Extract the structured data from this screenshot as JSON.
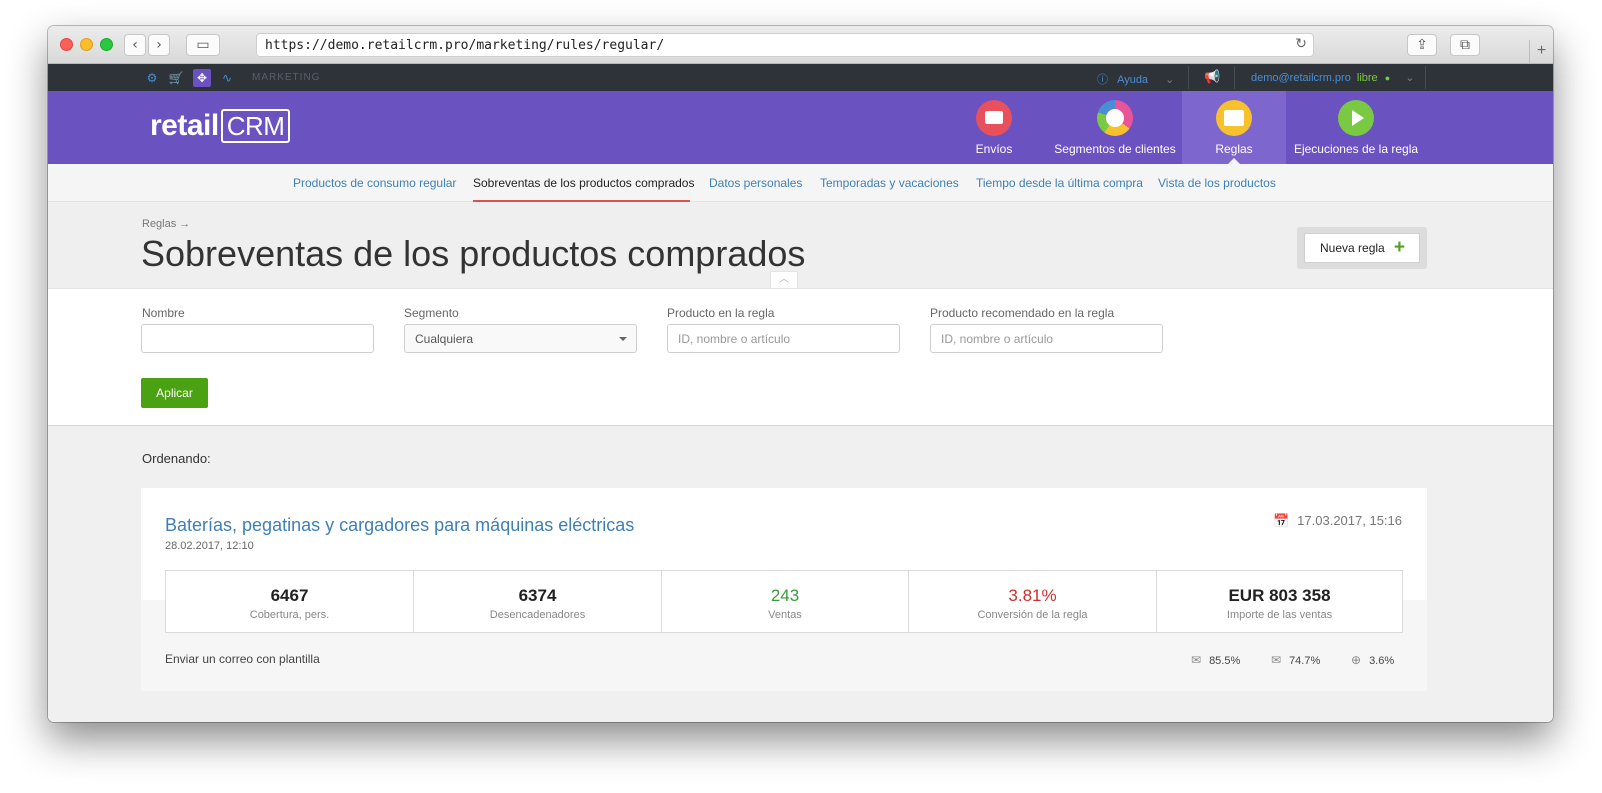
{
  "browser": {
    "url": "https://demo.retailcrm.pro/marketing/rules/regular/"
  },
  "appbar": {
    "section_label": "MARKETING",
    "help_label": "Ayuda",
    "user_email": "demo@retailcrm.pro",
    "user_status": "libre",
    "accent_color": "#4a8fd6"
  },
  "header": {
    "logo_text": "retail",
    "logo_crm": "CRM",
    "brand_color": "#6a52c1",
    "nav": [
      {
        "label": "Envíos",
        "icon": "envelope-icon",
        "color": "#e8505b"
      },
      {
        "label": "Segmentos de clientes",
        "icon": "segment-chart-icon",
        "color": "#e9539a"
      },
      {
        "label": "Reglas",
        "icon": "rules-list-icon",
        "color": "#f6c12d"
      },
      {
        "label": "Ejecuciones de la regla",
        "icon": "play-icon",
        "color": "#7ac943"
      }
    ]
  },
  "subnav": {
    "tabs": [
      "Productos de consumo regular",
      "Sobreventas de los productos comprados",
      "Datos personales",
      "Temporadas y vacaciones",
      "Tiempo desde la última compra",
      "Vista de los productos"
    ],
    "active_index": 1
  },
  "page": {
    "breadcrumb": "Reglas →",
    "title": "Sobreventas de los productos comprados",
    "new_rule_label": "Nueva regla",
    "new_rule_plus": "+"
  },
  "filters": {
    "name_label": "Nombre",
    "name_value": "",
    "segment_label": "Segmento",
    "segment_value": "Cualquiera",
    "product_label": "Producto en la regla",
    "product_placeholder": "ID, nombre o artículo",
    "recommended_label": "Producto recomendado en la regla",
    "recommended_placeholder": "ID, nombre o artículo",
    "apply_label": "Aplicar"
  },
  "list": {
    "ordering_label": "Ordenando:",
    "rules": [
      {
        "title": "Baterías, pegatinas y cargadores para máquinas eléctricas",
        "created": "28.02.2017, 12:10",
        "updated": "17.03.2017, 15:16",
        "stats": [
          {
            "value": "6467",
            "label": "Cobertura, pers.",
            "color": "#222222"
          },
          {
            "value": "6374",
            "label": "Desencadenadores",
            "color": "#222222"
          },
          {
            "value": "243",
            "label": "Ventas",
            "color": "#3c9a3c"
          },
          {
            "value": "3.81%",
            "label": "Conversión de la regla",
            "color": "#c9302c"
          },
          {
            "value": "EUR 803 358",
            "label": "Importe de las ventas",
            "color": "#222222"
          }
        ],
        "action": "Enviar un correo con plantilla",
        "metrics": [
          {
            "icon": "mail-sent-icon",
            "value": "85.5%"
          },
          {
            "icon": "mail-open-icon",
            "value": "74.7%"
          },
          {
            "icon": "globe-icon",
            "value": "3.6%"
          }
        ]
      }
    ]
  }
}
